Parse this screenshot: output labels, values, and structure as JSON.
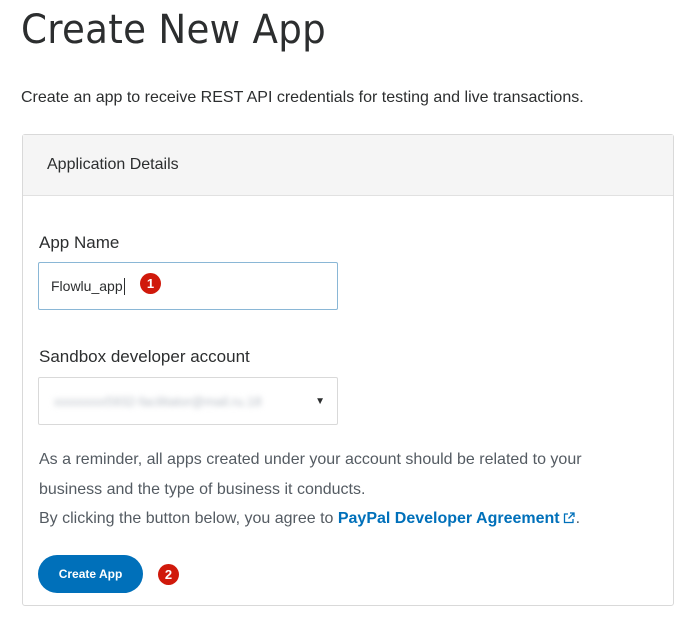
{
  "page": {
    "title": "Create New App",
    "subtitle": "Create an app to receive REST API credentials for testing and live transactions."
  },
  "panel": {
    "header": "Application Details",
    "app_name": {
      "label": "App Name",
      "value": "Flowlu_app",
      "badge": "1"
    },
    "sandbox": {
      "label": "Sandbox developer account",
      "value": "xxxxxxxx5932-facilitator@mail.ru.18",
      "arrow": "▼"
    },
    "reminder": {
      "line1": "As a reminder, all apps created under your account should be related to your",
      "line2": "business and the type of business it conducts.",
      "line3_prefix": "By clicking the button below, you agree to ",
      "link_text": "PayPal Developer Agreement",
      "line3_suffix": "."
    },
    "create_button": {
      "label": "Create App",
      "badge": "2"
    }
  },
  "colors": {
    "accent": "#0070ba",
    "badge": "#d0190b",
    "header_bg": "#f5f5f5"
  },
  "icons": {
    "external_link": "external-link-icon",
    "dropdown": "chevron-down-icon"
  }
}
